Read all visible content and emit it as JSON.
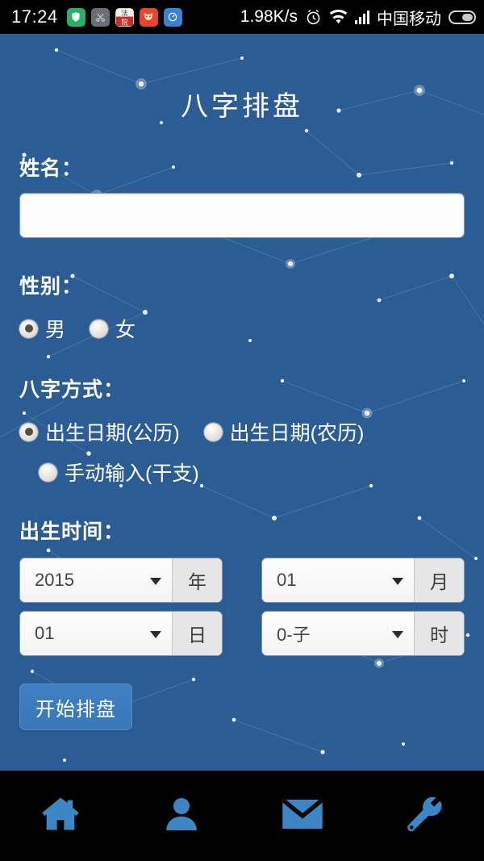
{
  "statusbar": {
    "time": "17:24",
    "app_icons": [
      {
        "name": "shield-app-icon",
        "glyph": "✔",
        "color": "#26b06a"
      },
      {
        "name": "scissors-app-icon",
        "glyph": "✂",
        "color": "#6b6e72"
      },
      {
        "name": "red-text-app-icon",
        "glyph": "法",
        "color": "#d8d5cc"
      },
      {
        "name": "fox-app-icon",
        "glyph": "◔",
        "color": "#e8452c"
      },
      {
        "name": "compass-app-icon",
        "glyph": "○",
        "color": "#3d7fd4"
      }
    ],
    "network_speed": "1.98K/s",
    "alarm_icon": "alarm-clock-icon",
    "wifi_icon": "wifi-icon",
    "signal_icon": "cellular-signal-icon",
    "carrier": "中国移动",
    "battery_icon": "battery-icon"
  },
  "page": {
    "title": "八字排盘",
    "background_color": "#2c5c94"
  },
  "form": {
    "name": {
      "label": "姓名：",
      "value": "",
      "placeholder": ""
    },
    "gender": {
      "label": "性别：",
      "options": [
        {
          "label": "男",
          "selected": true
        },
        {
          "label": "女",
          "selected": false
        }
      ]
    },
    "mode": {
      "label": "八字方式：",
      "options": [
        {
          "label": "出生日期(公历)",
          "selected": true
        },
        {
          "label": "出生日期(农历)",
          "selected": false
        },
        {
          "label": "手动输入(干支)",
          "selected": false
        }
      ]
    },
    "birth_time": {
      "label": "出生时间：",
      "selects": [
        {
          "name": "year",
          "value": "2015",
          "suffix": "年"
        },
        {
          "name": "month",
          "value": "01",
          "suffix": "月"
        },
        {
          "name": "day",
          "value": "01",
          "suffix": "日"
        },
        {
          "name": "hour",
          "value": "0-子",
          "suffix": "时"
        }
      ]
    },
    "submit": {
      "label": "开始排盘",
      "color": "#3f81c4"
    }
  },
  "navbar": {
    "items": [
      {
        "name": "nav-home",
        "icon": "home-icon"
      },
      {
        "name": "nav-profile",
        "icon": "person-icon"
      },
      {
        "name": "nav-messages",
        "icon": "envelope-icon"
      },
      {
        "name": "nav-tools",
        "icon": "wrench-icon"
      }
    ],
    "icon_color": "#3d86c6"
  }
}
